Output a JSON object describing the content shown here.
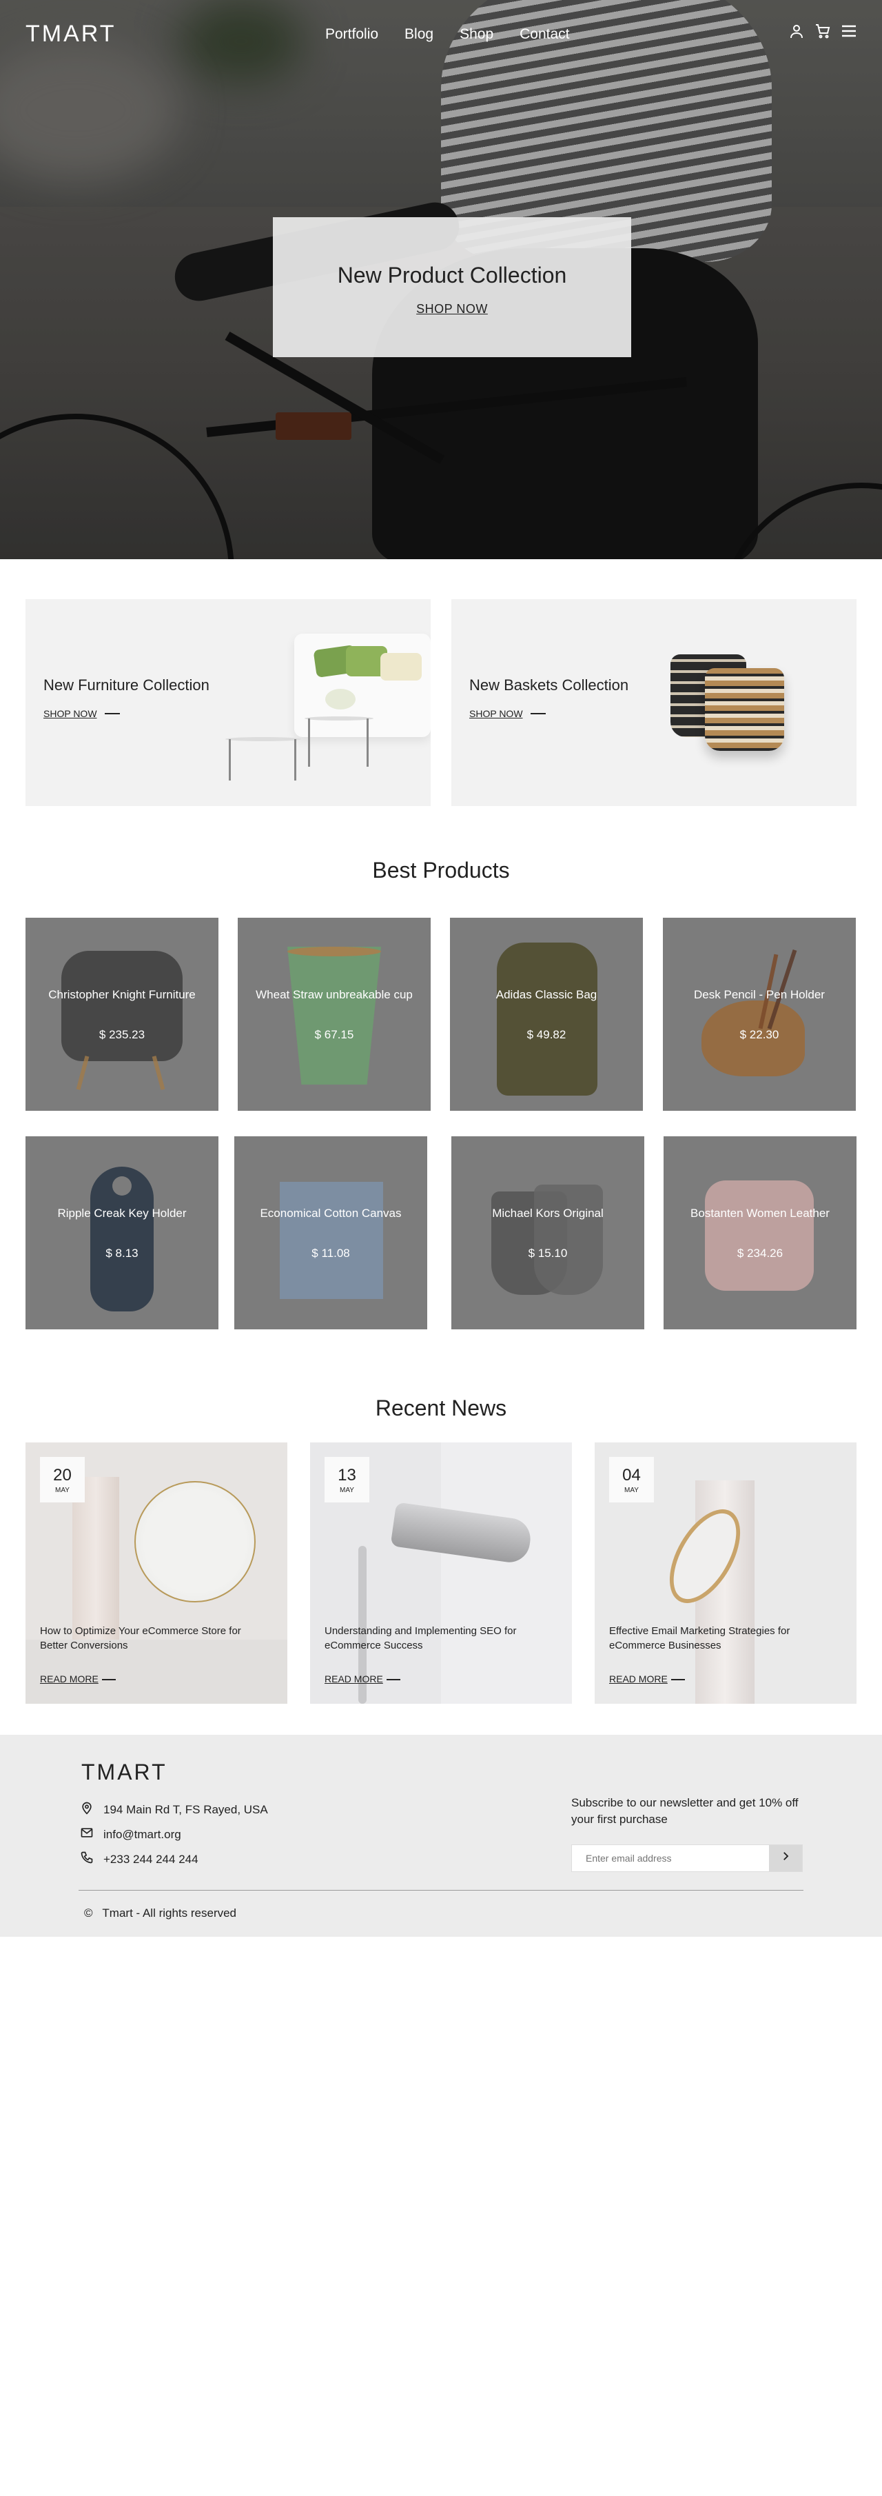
{
  "header": {
    "logo": "TMART",
    "menu": [
      "Portfolio",
      "Blog",
      "Shop",
      "Contact"
    ],
    "icons": [
      "user-icon",
      "cart-icon",
      "menu-icon"
    ]
  },
  "hero": {
    "title": "New Product Collection",
    "cta": "SHOP NOW"
  },
  "collections": [
    {
      "title": "New Furniture Collection",
      "cta": "SHOP NOW"
    },
    {
      "title": "New Baskets Collection",
      "cta": "SHOP NOW"
    }
  ],
  "best_products": {
    "title": "Best Products",
    "items": [
      {
        "name": "Christopher Knight Furniture",
        "price": "$ 235.23"
      },
      {
        "name": "Wheat Straw unbreakable cup",
        "price": "$ 67.15"
      },
      {
        "name": "Adidas Classic Bag",
        "price": "$ 49.82"
      },
      {
        "name": "Desk Pencil - Pen Holder",
        "price": "$ 22.30"
      },
      {
        "name": "Ripple Creak Key Holder",
        "price": "$ 8.13"
      },
      {
        "name": "Economical Cotton Canvas",
        "price": "$ 11.08"
      },
      {
        "name": "Michael Kors Original",
        "price": "$ 15.10"
      },
      {
        "name": "Bostanten Women Leather",
        "price": "$ 234.26"
      }
    ]
  },
  "recent_news": {
    "title": "Recent News",
    "items": [
      {
        "day": "20",
        "month": "MAY",
        "title": "How to Optimize Your eCommerce Store for Better Conversions",
        "cta": "READ MORE"
      },
      {
        "day": "13",
        "month": "MAY",
        "title": "Understanding and Implementing SEO for eCommerce Success",
        "cta": "READ MORE"
      },
      {
        "day": "04",
        "month": "MAY",
        "title": "Effective Email Marketing Strategies for eCommerce Businesses",
        "cta": "READ MORE"
      }
    ]
  },
  "footer": {
    "logo": "TMART",
    "address": "194 Main Rd T, FS Rayed, USA",
    "email": "info@tmart.org",
    "phone": "+233 244 244 244",
    "newsletter": "Subscribe to our newsletter and get 10% off your first purchase",
    "email_placeholder": "Enter email address",
    "copyright_symbol": "©",
    "copyright": "Tmart - All rights reserved"
  }
}
